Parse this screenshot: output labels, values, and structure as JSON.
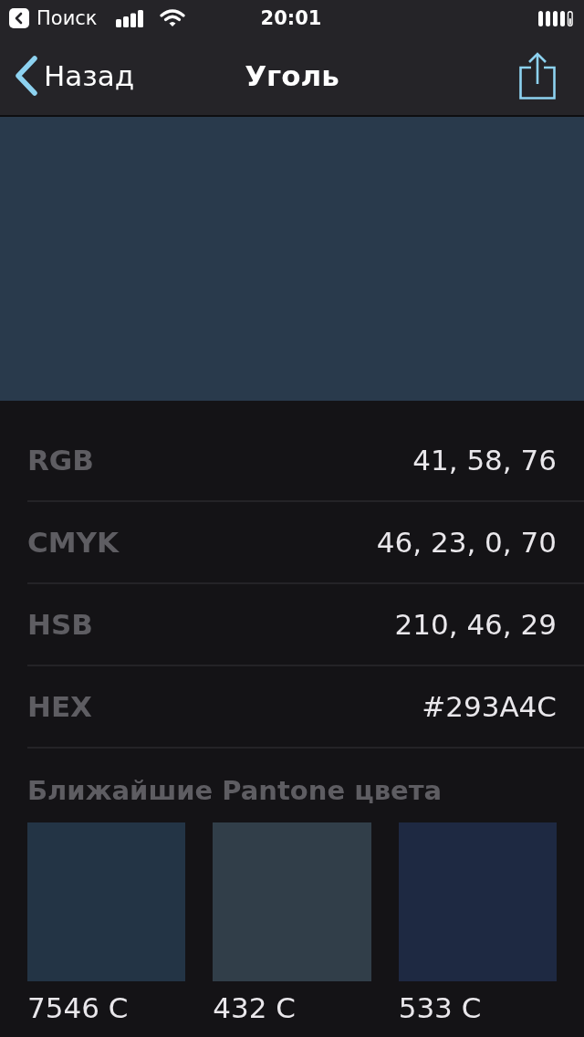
{
  "status_bar": {
    "back_app": "Поиск",
    "time": "20:01"
  },
  "nav": {
    "back": "Назад",
    "title": "Уголь"
  },
  "preview": {
    "color": "#293a4c"
  },
  "values": [
    {
      "label": "RGB",
      "value": "41, 58, 76"
    },
    {
      "label": "CMYK",
      "value": "46, 23, 0, 70"
    },
    {
      "label": "HSB",
      "value": "210, 46, 29"
    },
    {
      "label": "HEX",
      "value": "#293A4C"
    }
  ],
  "pantone": {
    "title": "Ближайшие Pantone цвета",
    "swatches": [
      {
        "name": "7546 C",
        "color": "#233445"
      },
      {
        "name": "432 C",
        "color": "#313e49"
      },
      {
        "name": "533 C",
        "color": "#1e2942"
      }
    ]
  }
}
